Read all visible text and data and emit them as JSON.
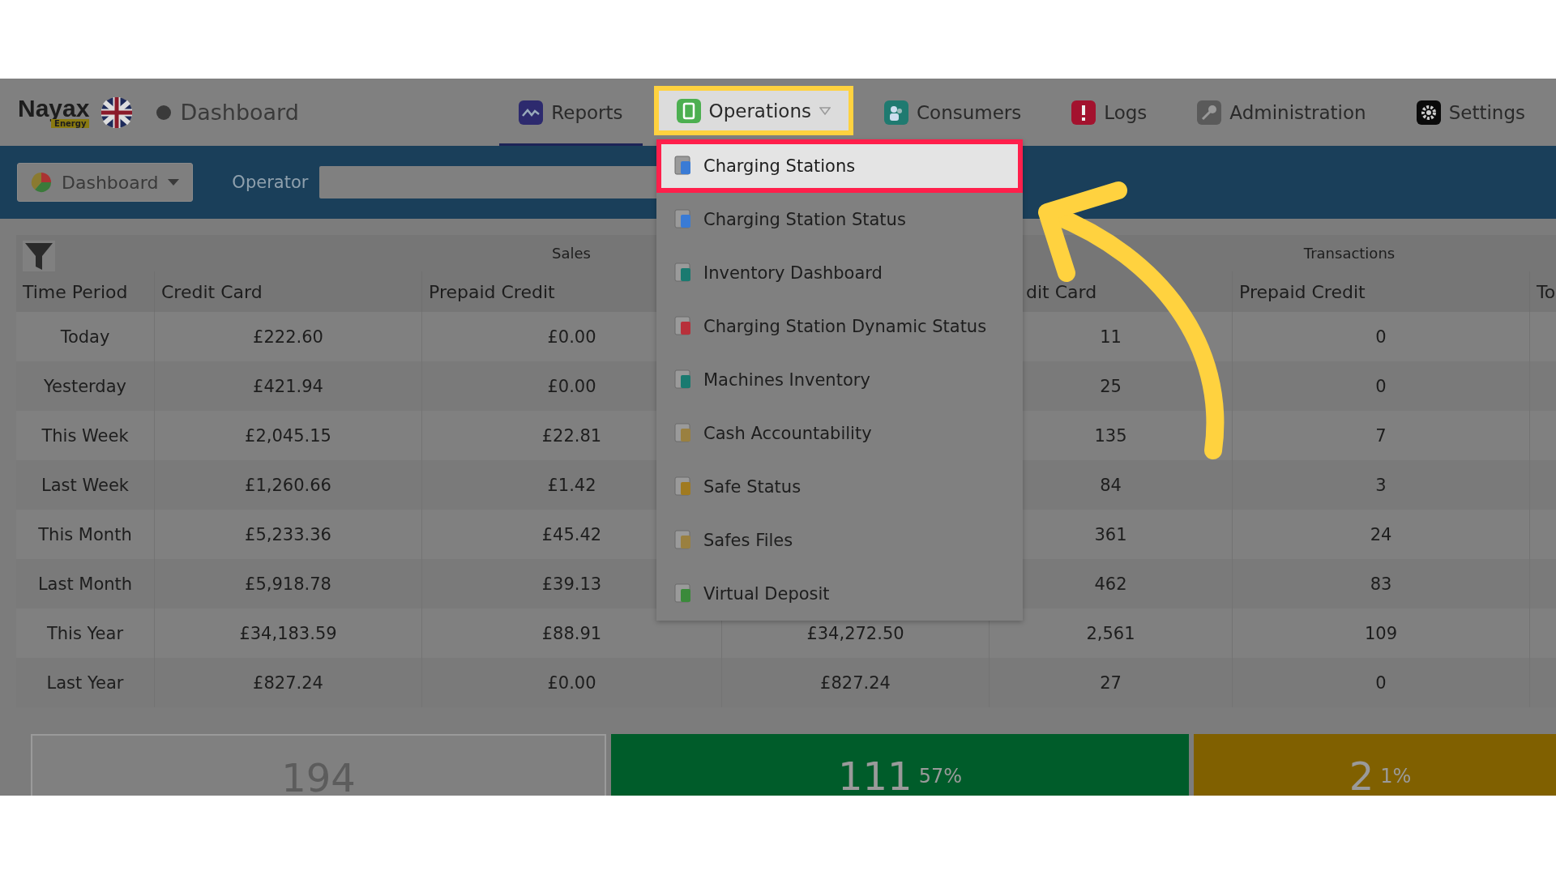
{
  "header": {
    "logo": "Nayax",
    "logo_badge": "Energy",
    "page_title": "Dashboard"
  },
  "nav": [
    {
      "label": "Reports",
      "kind": "link",
      "selected": true,
      "expanded": false
    },
    {
      "label": "Operations",
      "kind": "menu",
      "selected": false,
      "expanded": true
    },
    {
      "label": "Consumers",
      "kind": "link",
      "selected": false,
      "expanded": false
    },
    {
      "label": "Logs",
      "kind": "link",
      "selected": false,
      "expanded": false
    },
    {
      "label": "Administration",
      "kind": "link",
      "selected": false,
      "expanded": false
    },
    {
      "label": "Settings",
      "kind": "link",
      "selected": false,
      "expanded": false
    }
  ],
  "toolbar": {
    "view_button": "Dashboard",
    "operator_label": "Operator"
  },
  "dropdown": {
    "items": [
      {
        "label": "Charging Stations",
        "selected": true
      },
      {
        "label": "Charging Station Status",
        "selected": false
      },
      {
        "label": "Inventory Dashboard",
        "selected": false
      },
      {
        "label": "Charging Station Dynamic Status",
        "selected": false
      },
      {
        "label": "Machines Inventory",
        "selected": false
      },
      {
        "label": "Cash Accountability",
        "selected": false
      },
      {
        "label": "Safe Status",
        "selected": false
      },
      {
        "label": "Safes Files",
        "selected": false
      },
      {
        "label": "Virtual Deposit",
        "selected": false
      }
    ]
  },
  "table": {
    "groups": [
      "Sales",
      "Transactions"
    ],
    "columns": [
      "Time Period",
      "Credit Card",
      "Prepaid Credit",
      null,
      "dit Card",
      "Prepaid Credit",
      "To"
    ],
    "rows": [
      [
        "Today",
        "£222.60",
        "£0.00",
        null,
        "11",
        "0"
      ],
      [
        "Yesterday",
        "£421.94",
        "£0.00",
        null,
        "25",
        "0"
      ],
      [
        "This Week",
        "£2,045.15",
        "£22.81",
        null,
        "135",
        "7"
      ],
      [
        "Last Week",
        "£1,260.66",
        "£1.42",
        null,
        "84",
        "3"
      ],
      [
        "This Month",
        "£5,233.36",
        "£45.42",
        null,
        "361",
        "24"
      ],
      [
        "Last Month",
        "£5,918.78",
        "£39.13",
        null,
        "462",
        "83"
      ],
      [
        "This Year",
        "£34,183.59",
        "£88.91",
        "£34,272.50",
        "2,561",
        "109"
      ],
      [
        "Last Year",
        "£827.24",
        "£0.00",
        "£827.24",
        "27",
        "0"
      ]
    ]
  },
  "summary": [
    {
      "value": "194",
      "color": "#808080"
    },
    {
      "value": "111",
      "percent": "57%",
      "color": "#005c2a"
    },
    {
      "value": "2",
      "percent": "1%",
      "color": "#806000"
    }
  ]
}
